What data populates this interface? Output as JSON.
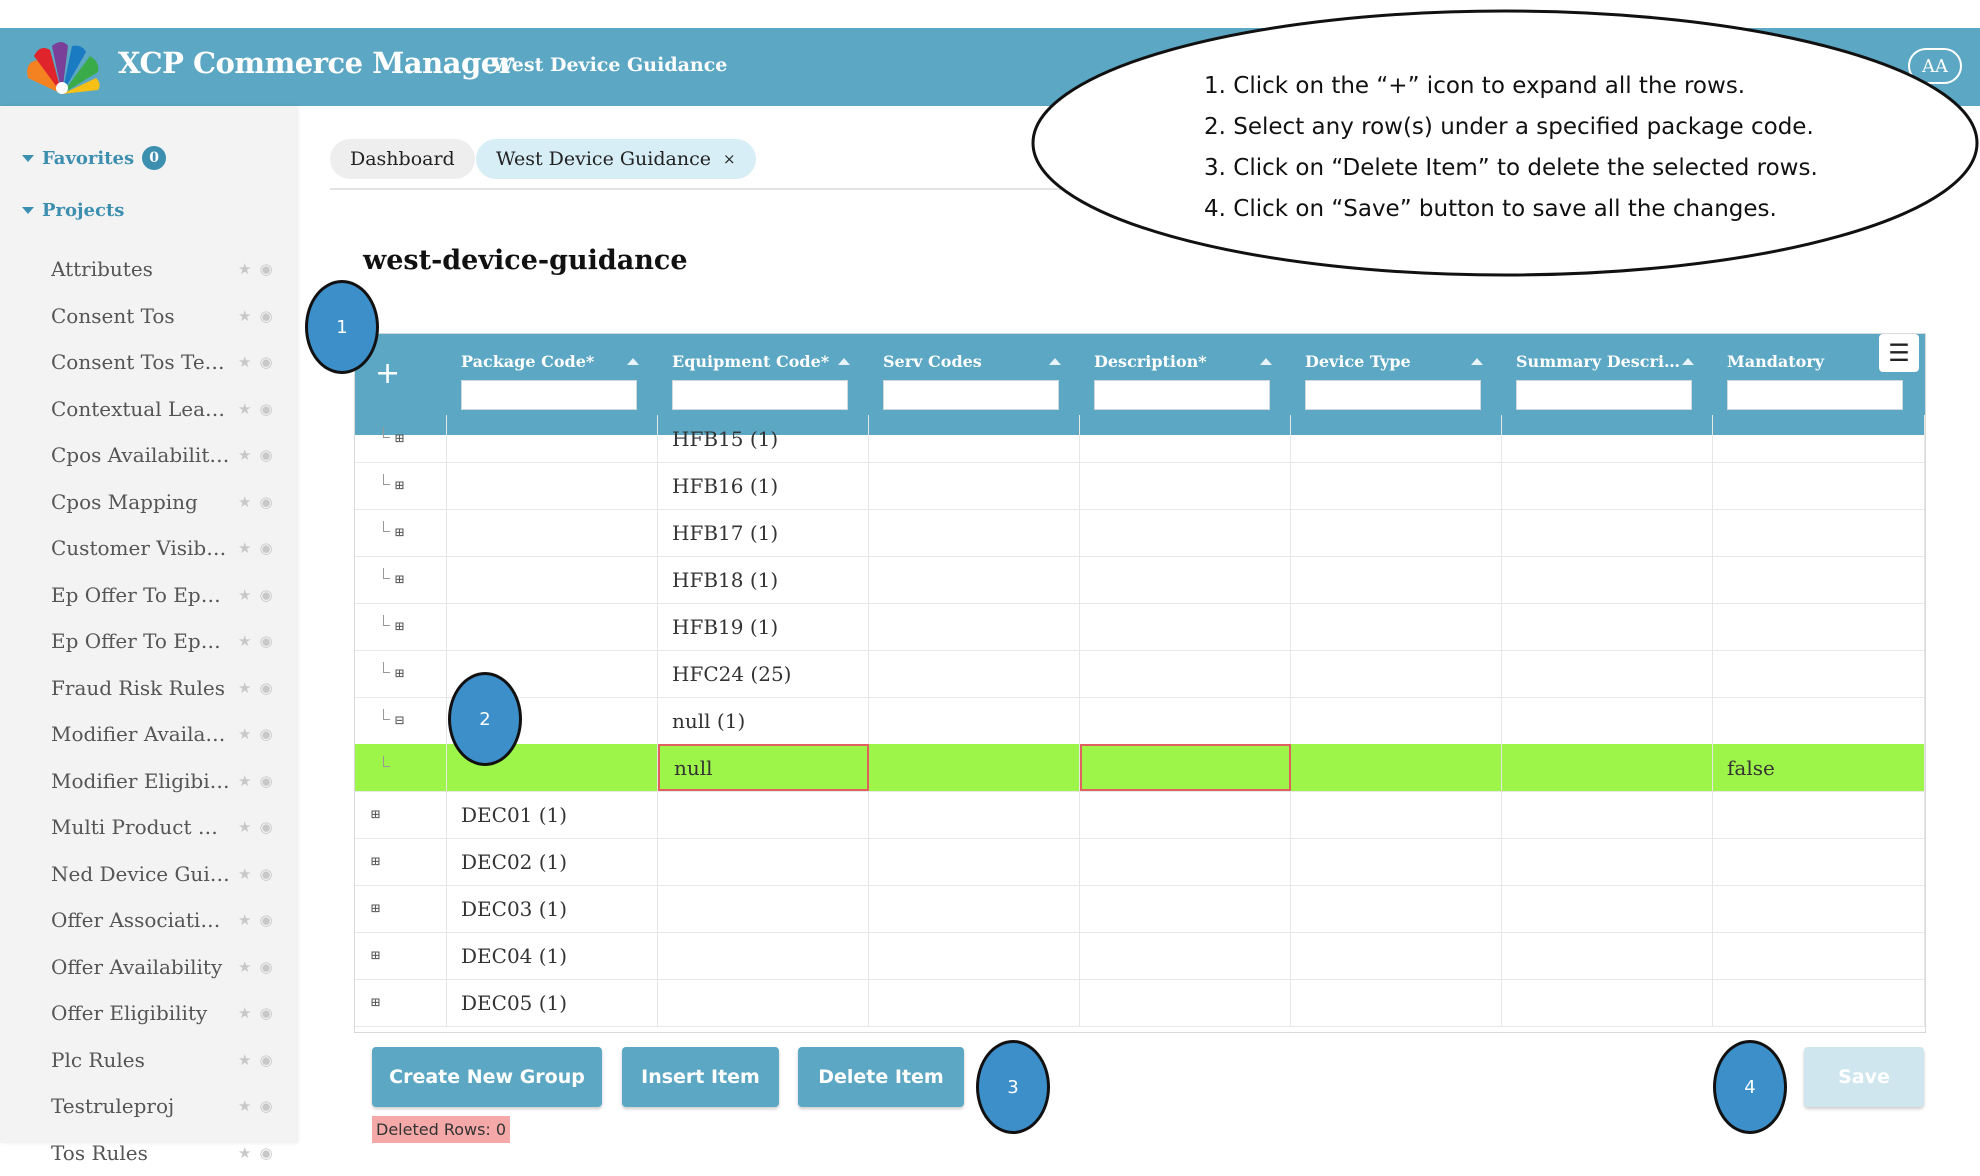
{
  "header": {
    "app_title": "XCP Commerce Manager",
    "subtitle": "West Device Guidance",
    "avatar": "AA"
  },
  "sidebar": {
    "favorites_label": "Favorites",
    "favorites_count": "0",
    "projects_label": "Projects",
    "items": [
      {
        "label": "Attributes"
      },
      {
        "label": "Consent Tos"
      },
      {
        "label": "Consent Tos Ter…"
      },
      {
        "label": "Contextual Lear…"
      },
      {
        "label": "Cpos Availabilit…"
      },
      {
        "label": "Cpos Mapping"
      },
      {
        "label": "Customer Visibility"
      },
      {
        "label": "Ep Offer To Epc …"
      },
      {
        "label": "Ep Offer To Epc …"
      },
      {
        "label": "Fraud Risk Rules"
      },
      {
        "label": "Modifier Availab…"
      },
      {
        "label": "Modifier Eligibility"
      },
      {
        "label": "Multi Product Di…"
      },
      {
        "label": "Ned Device Gui…"
      },
      {
        "label": "Offer Associatio…"
      },
      {
        "label": "Offer Availability"
      },
      {
        "label": "Offer Eligibility"
      },
      {
        "label": "Plc Rules"
      },
      {
        "label": "Testruleproj"
      },
      {
        "label": "Tos Rules"
      }
    ],
    "star_icon": "★",
    "eye_icon": "◉"
  },
  "tabs": {
    "dashboard": "Dashboard",
    "active": "West Device Guidance",
    "close": "×"
  },
  "page_title": "west-device-guidance",
  "grid": {
    "expand_all": "+",
    "menu": "☰",
    "columns": [
      {
        "label": "Package Code*"
      },
      {
        "label": "Equipment Code*"
      },
      {
        "label": "Serv Codes"
      },
      {
        "label": "Description*"
      },
      {
        "label": "Device Type"
      },
      {
        "label": "Summary Descri…"
      },
      {
        "label": "Mandatory"
      }
    ],
    "child_rows": [
      {
        "equipment": "HFB15 (1)"
      },
      {
        "equipment": "HFB16 (1)"
      },
      {
        "equipment": "HFB17 (1)"
      },
      {
        "equipment": "HFB18 (1)"
      },
      {
        "equipment": "HFB19 (1)"
      },
      {
        "equipment": "HFC24 (25)"
      },
      {
        "equipment": "null (1)"
      }
    ],
    "selected_row": {
      "equipment": "null",
      "mandatory": "false"
    },
    "group_rows": [
      {
        "package": "DEC01 (1)"
      },
      {
        "package": "DEC02 (1)"
      },
      {
        "package": "DEC03 (1)"
      },
      {
        "package": "DEC04 (1)"
      },
      {
        "package": "DEC05 (1)"
      }
    ],
    "expand_icon": "⊞",
    "collapse_icon": "⊟"
  },
  "buttons": {
    "create_group": "Create New Group",
    "insert_item": "Insert Item",
    "delete_item": "Delete Item",
    "save": "Save"
  },
  "deleted_rows": "Deleted Rows: 0",
  "annotation": {
    "steps": [
      "1. Click on the “+” icon to expand all the rows.",
      "2. Select any row(s) under a specified package code.",
      "3. Click on “Delete Item” to delete the selected rows.",
      "4. Click on “Save” button to save all the changes."
    ],
    "markers": [
      "1",
      "2",
      "3",
      "4"
    ]
  },
  "colors": {
    "header": "#5ca7c3",
    "accent": "#3d8fb0",
    "selected_row": "#9ef54a",
    "deleted_badge": "#f4a8a8"
  }
}
